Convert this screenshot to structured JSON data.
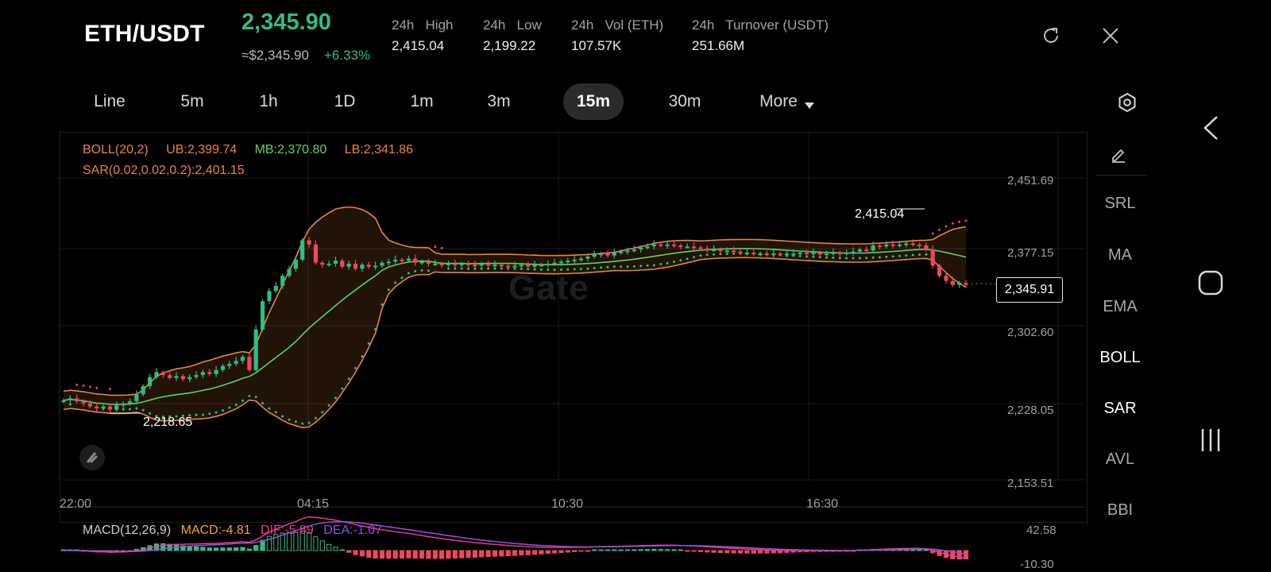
{
  "header": {
    "pair": "ETH/USDT",
    "price": "2,345.90",
    "approx_price": "≈$2,345.90",
    "change": "+6.33%",
    "stats": [
      {
        "label": "24h   High",
        "value": "2,415.04"
      },
      {
        "label": "24h   Low",
        "value": "2,199.22"
      },
      {
        "label": "24h   Vol (ETH)",
        "value": "107.57K"
      },
      {
        "label": "24h   Turnover (USDT)",
        "value": "251.66M"
      }
    ]
  },
  "tabs": [
    "Line",
    "5m",
    "1h",
    "1D",
    "1m",
    "3m",
    "15m",
    "30m",
    "More"
  ],
  "active_tab": "15m",
  "indicator_buttons": [
    "SRL",
    "MA",
    "EMA",
    "BOLL",
    "SAR",
    "AVL",
    "BBI"
  ],
  "active_indicators": [
    "BOLL",
    "SAR"
  ],
  "legend": {
    "boll": "BOLL(20,2)",
    "ub": "UB:2,399.74",
    "mb": "MB:2,370.80",
    "lb": "LB:2,341.86",
    "sar": "SAR(0.02,0.02,0.2):2,401.15",
    "macd_name": "MACD(12,26,9)",
    "macd": "MACD:-4.81",
    "dif": "DIF:-5.89",
    "dea": "DEA:-1.07"
  },
  "y_axis_labels": [
    "2,451.69",
    "2,377.15",
    "2,302.60",
    "2,228.05",
    "2,153.51"
  ],
  "x_axis_labels": [
    "22:00",
    "04:15",
    "10:30",
    "16:30"
  ],
  "macd_axis_labels": [
    "42.58",
    "-10.30"
  ],
  "annotations": {
    "high": "2,415.04",
    "low": "2,218.65",
    "last_price": "2,345.91"
  },
  "watermark": "Gate",
  "colors": {
    "up": "#2fbd85",
    "down": "#f0465a",
    "boll_band": "#e8853c",
    "mid": "#5fd35f",
    "sar_up": "#2fbd85",
    "sar_down": "#f0465a",
    "macd": "#f6a623",
    "dif": "#e83a8e",
    "dea": "#9b4de0"
  },
  "chart_data": {
    "type": "candlestick",
    "interval": "15m",
    "ylim": [
      2153.51,
      2451.69
    ],
    "x_ticks": [
      "22:00",
      "04:15",
      "10:30",
      "16:30"
    ],
    "close_series": [
      2232,
      2234,
      2231,
      2229,
      2226,
      2224,
      2226,
      2223,
      2227,
      2229,
      2231,
      2238,
      2246,
      2255,
      2260,
      2257,
      2254,
      2256,
      2253,
      2255,
      2257,
      2260,
      2258,
      2262,
      2266,
      2268,
      2271,
      2275,
      2262,
      2302,
      2330,
      2340,
      2345,
      2355,
      2362,
      2371,
      2390,
      2386,
      2368,
      2366,
      2367,
      2370,
      2364,
      2367,
      2362,
      2366,
      2364,
      2365,
      2368,
      2369,
      2371,
      2370,
      2372,
      2368,
      2369,
      2367,
      2367,
      2366,
      2367,
      2366,
      2367,
      2366,
      2365,
      2367,
      2365,
      2366,
      2365,
      2364,
      2365,
      2366,
      2364,
      2366,
      2366,
      2367,
      2368,
      2369,
      2370,
      2371,
      2372,
      2374,
      2376,
      2377,
      2375,
      2378,
      2379,
      2380,
      2381,
      2383,
      2384,
      2386,
      2385,
      2386,
      2385,
      2384,
      2384,
      2383,
      2382,
      2381,
      2381,
      2380,
      2380,
      2379,
      2378,
      2378,
      2377,
      2377,
      2376,
      2377,
      2376,
      2377,
      2377,
      2378,
      2377,
      2378,
      2376,
      2377,
      2378,
      2377,
      2378,
      2379,
      2381,
      2380,
      2385,
      2384,
      2386,
      2385,
      2386,
      2387,
      2386,
      2385,
      2381,
      2365,
      2355,
      2350,
      2346,
      2348,
      2346
    ],
    "high": 2415.04,
    "low": 2218.65,
    "last": 2345.91,
    "indicators": {
      "BOLL": {
        "UB": 2399.74,
        "MB": 2370.8,
        "LB": 2341.86
      },
      "SAR": 2401.15,
      "MACD": {
        "MACD": -4.81,
        "DIF": -5.89,
        "DEA": -1.07,
        "ylim": [
          -10.3,
          42.58
        ]
      }
    }
  }
}
